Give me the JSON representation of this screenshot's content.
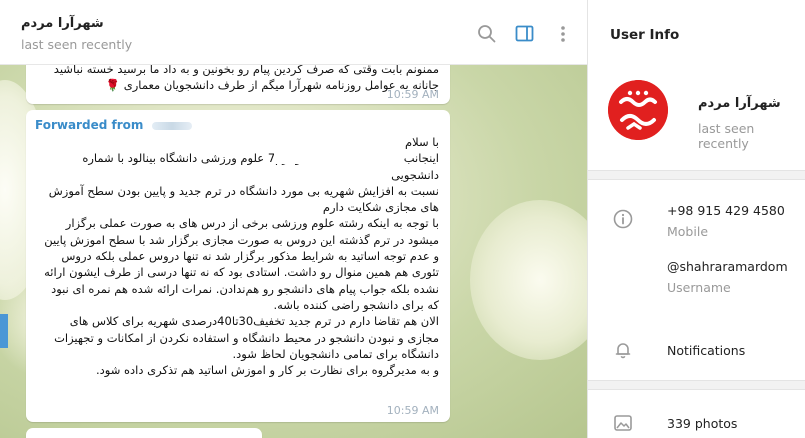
{
  "chat": {
    "peer_name": "شهرآرا مردم",
    "peer_status": "last seen recently",
    "messages": [
      {
        "text": "ممنونم بابت وقتی که صرف کردین پیام رو بخونین و به داد ما برسید خسته نباشید\nجانانه به عوامل روزنامه شهرآرا میگم از طرف دانشجویان معماری 🌹",
        "time": "10:59 AM"
      },
      {
        "forwarded_label": "Forwarded from",
        "text": "با سلام\nاینجانب                    دانشجو ترم7 علوم ورزشی دانشگاه بینالود با شماره\nدانشجویی\nنسبت به افزایش شهریه بی مورد دانشگاه در ترم جدید و پایین بودن سطح آموزش\nهای مجازی شکایت دارم\nبا توجه به اینکه رشته علوم ورزشی برخی از درس های به صورت عملی برگزار\nمیشود در ترم گذشته این دروس به صورت مجازی برگزار شد با سطح اموزش پایین\nو عدم توجه اساتید به شرایط مذکور برگزار شد نه تنها دروس عملی بلکه دروس\nتئوری هم همین منوال رو داشت. استادی بود که نه تنها درسی از طرف ایشون ارائه\nنشده بلکه جواب پیام های دانشجو رو هم‌ندادن. نمرات ارائه شده هم نمره ای نبود\nکه برای دانشجو راضی کننده باشه.\nالان هم تقاضا دارم در ترم جدید تخفیف30تا40درصدی شهریه برای کلاس های\nمجازی و نبودن دانشجو در محیط دانشگاه و استفاده نکردن از امکانات و تجهیزات\nدانشگاه برای تمامی دانشجویان لحاظ شود.\nو به مدیرگروه برای نظارت بر کار و اموزش اساتید هم تذکری داده شود.",
        "time": "10:59 AM"
      }
    ]
  },
  "header_icons": [
    "search-icon",
    "sidebar-toggle-icon",
    "more-vertical-icon"
  ],
  "panel": {
    "title": "User Info",
    "name": "شهرآرا مردم",
    "status": "last seen recently",
    "phone": "+98 915 429 4580",
    "phone_label": "Mobile",
    "username": "@shahraramardom",
    "username_label": "Username",
    "notifications_label": "Notifications",
    "photos_label": "339 photos"
  },
  "colors": {
    "accent": "#3a8cc9",
    "avatar_red": "#e1201f",
    "time": "#a3b1be"
  }
}
